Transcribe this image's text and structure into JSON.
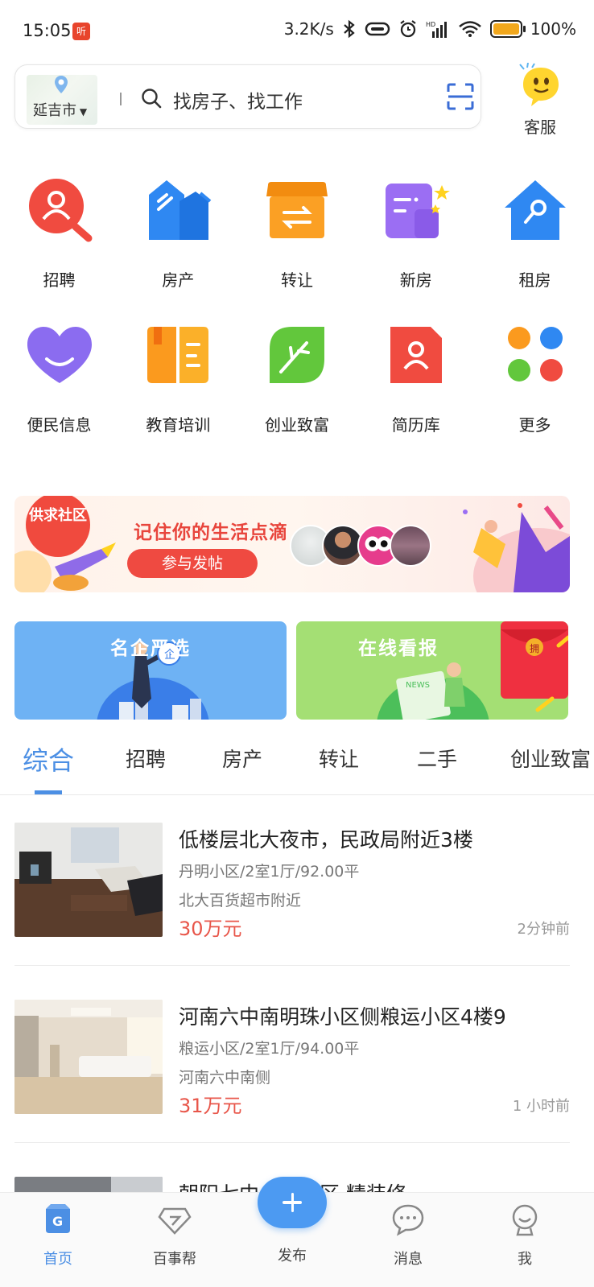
{
  "status_bar": {
    "time": "15:05",
    "net_speed": "3.2K/s",
    "battery": "100%",
    "battery_level": 1.0
  },
  "search": {
    "city": "延吉市",
    "placeholder": "找房子、找工作"
  },
  "service": {
    "label": "客服"
  },
  "categories": [
    {
      "label": "招聘",
      "icon": "recruit-icon"
    },
    {
      "label": "房产",
      "icon": "property-icon"
    },
    {
      "label": "转让",
      "icon": "transfer-icon"
    },
    {
      "label": "新房",
      "icon": "new-house-icon"
    },
    {
      "label": "租房",
      "icon": "rent-icon"
    },
    {
      "label": "便民信息",
      "icon": "convenience-icon"
    },
    {
      "label": "教育培训",
      "icon": "education-icon"
    },
    {
      "label": "创业致富",
      "icon": "business-icon"
    },
    {
      "label": "简历库",
      "icon": "resume-icon"
    },
    {
      "label": "更多",
      "icon": "more-icon"
    }
  ],
  "banner": {
    "badge": "供求社区",
    "title": "记住你的生活点滴",
    "button": "参与发帖"
  },
  "cards": [
    {
      "title": "名企严选"
    },
    {
      "title": "在线看报"
    }
  ],
  "tabs": [
    "综合",
    "招聘",
    "房产",
    "转让",
    "二手",
    "创业致富"
  ],
  "listings": [
    {
      "title": "低楼层北大夜市，民政局附近3楼",
      "meta": "丹明小区/2室1厅/92.00平",
      "location": "北大百货超市附近",
      "price": "30万元",
      "time": "2分钟前"
    },
    {
      "title": "河南六中南明珠小区侧粮运小区4楼9",
      "meta": "粮运小区/2室1厅/94.00平",
      "location": "河南六中南侧",
      "price": "31万元",
      "time": "1 小时前"
    },
    {
      "title": "朝阳七中…通小区 精装修"
    }
  ],
  "bottom_nav": [
    {
      "label": "首页",
      "icon": "home-icon"
    },
    {
      "label": "百事帮",
      "icon": "diamond-icon"
    },
    {
      "label": "发布",
      "icon": "plus-icon"
    },
    {
      "label": "消息",
      "icon": "message-icon"
    },
    {
      "label": "我",
      "icon": "profile-icon"
    }
  ],
  "colors": {
    "accent": "#4c8fe4",
    "price": "#e8564a",
    "banner_red": "#ef4a41"
  }
}
